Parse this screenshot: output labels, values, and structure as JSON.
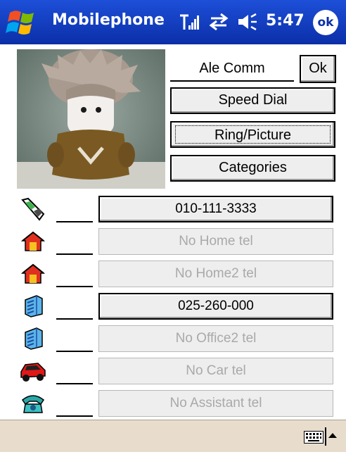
{
  "titlebar": {
    "app_title": "Mobilephone",
    "time": "5:47",
    "ok_label": "ok"
  },
  "contact": {
    "name": "Ale Comm",
    "ok_button": "Ok",
    "speed_dial": "Speed Dial",
    "ring_picture": "Ring/Picture",
    "categories": "Categories"
  },
  "phones": [
    {
      "icon": "mobile-phone-icon",
      "label": "010-111-3333",
      "enabled": true
    },
    {
      "icon": "home-icon",
      "label": "No Home tel",
      "enabled": false
    },
    {
      "icon": "home-icon",
      "label": "No Home2 tel",
      "enabled": false
    },
    {
      "icon": "office-building-icon",
      "label": "025-260-000",
      "enabled": true
    },
    {
      "icon": "office-building-icon",
      "label": "No Office2 tel",
      "enabled": false
    },
    {
      "icon": "car-icon",
      "label": "No Car tel",
      "enabled": false
    },
    {
      "icon": "assistant-phone-icon",
      "label": "No Assistant tel",
      "enabled": false
    }
  ],
  "colors": {
    "titlebar": "#0b2fa8",
    "bottombar": "#e8dccd",
    "disabled_text": "#a9a9a9"
  }
}
